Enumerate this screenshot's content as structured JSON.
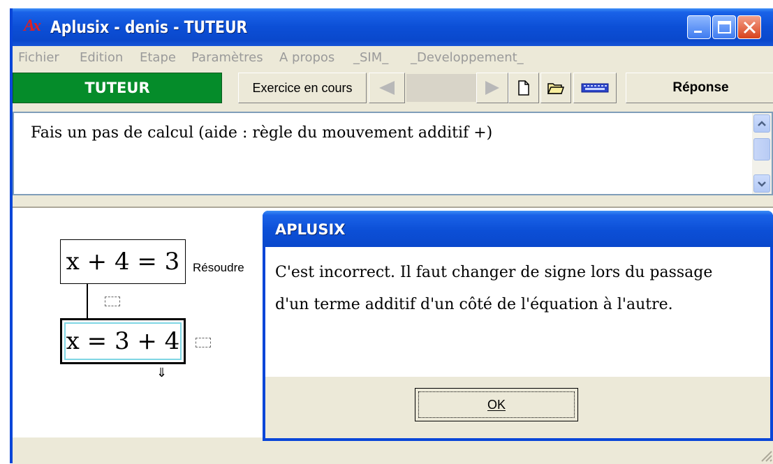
{
  "window": {
    "title": "Aplusix - denis - TUTEUR",
    "logo_text": "Ax"
  },
  "menu": [
    "Fichier",
    "Edition",
    "Etape",
    "Paramètres",
    "A propos",
    "_SIM_",
    "_Developpement_"
  ],
  "toolbar": {
    "mode_label": "TUTEUR",
    "exercise_label": "Exercice en cours",
    "answer_label": "Réponse",
    "mode_color": "#058c2a"
  },
  "message": {
    "text": "Fais un pas de calcul (aide : règle du mouvement additif +)"
  },
  "work": {
    "equation1": "x + 4 = 3",
    "equation1_label": "Résoudre",
    "equation2": "x = 3 + 4"
  },
  "dialog": {
    "title": "APLUSIX",
    "line1": "C'est incorrect. Il faut changer de signe lors du passage",
    "line2": "d'un terme additif d'un côté de l'équation à l'autre.",
    "ok_label": "OK"
  }
}
